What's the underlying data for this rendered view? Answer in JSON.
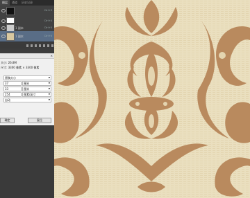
{
  "tabs": [
    "图层",
    "通道",
    "历史记录"
  ],
  "layers": [
    {
      "name": "",
      "mode": "Ctrl+3",
      "selected": false
    },
    {
      "name": "",
      "mode": "Ctrl+4",
      "selected": false
    },
    {
      "name": "1 副本",
      "mode": "Ctrl+5",
      "selected": false
    },
    {
      "name": "1 副本",
      "mode": "Ctrl+6",
      "selected": true
    }
  ],
  "dialog": {
    "size_label": "大小:",
    "size_value": "26.8M",
    "size_prefix": "尺寸:",
    "dimensions": "3300 像素 × 3300 像素",
    "fit_to": "原稿大小",
    "width_value": "37",
    "width_unit": "厘米",
    "height_value": "33",
    "height_unit": "厘米",
    "resolution_value": "254",
    "resolution_unit": "像素/英寸",
    "resample": "自动",
    "ok_label": "确定",
    "reset_label": "复位"
  },
  "colors": {
    "damask_dark": "#b98a5e",
    "damask_light": "#e9ddb9",
    "selected_row": "#596d86"
  }
}
